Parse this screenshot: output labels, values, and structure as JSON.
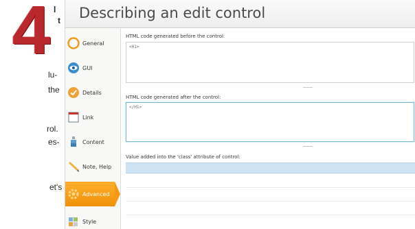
{
  "page_fragments": [
    {
      "text": "l",
      "bold": true
    },
    {
      "text": "t",
      "bold": true
    },
    {
      "text": "lu-",
      "bold": false
    },
    {
      "text": "the",
      "bold": false
    },
    {
      "text": "rol.",
      "bold": false
    },
    {
      "text": "es-",
      "bold": false
    },
    {
      "text": "et's",
      "bold": false
    }
  ],
  "chapter_number": "4",
  "dialog": {
    "title": "Describing an edit control",
    "nav_items": [
      {
        "label": "General",
        "icon": "orange-circle-icon",
        "selected": false
      },
      {
        "label": "GUI",
        "icon": "eye-icon",
        "selected": false
      },
      {
        "label": "Details",
        "icon": "badge-icon",
        "selected": false
      },
      {
        "label": "Link",
        "icon": "window-icon",
        "selected": false
      },
      {
        "label": "Content",
        "icon": "bottle-icon",
        "selected": false
      },
      {
        "label": "Note, Help",
        "icon": "pencil-icon",
        "selected": false
      },
      {
        "label": "Advanced",
        "icon": "gear-icon",
        "selected": true
      },
      {
        "label": "Style",
        "icon": "palette-icon",
        "selected": false
      }
    ],
    "fields": {
      "before_label": "HTML code generated before the control:",
      "before_value": "<H1>",
      "after_label": "HTML code generated after the control:",
      "after_value": "</H1>",
      "class_label": "Value added into the 'class' attribute of control:"
    },
    "colors": {
      "accent_orange": "#f59a14",
      "focus_blue": "#7bb7d6",
      "selection_blue": "#cde3f3",
      "chapter_red": "#b8282c"
    }
  }
}
